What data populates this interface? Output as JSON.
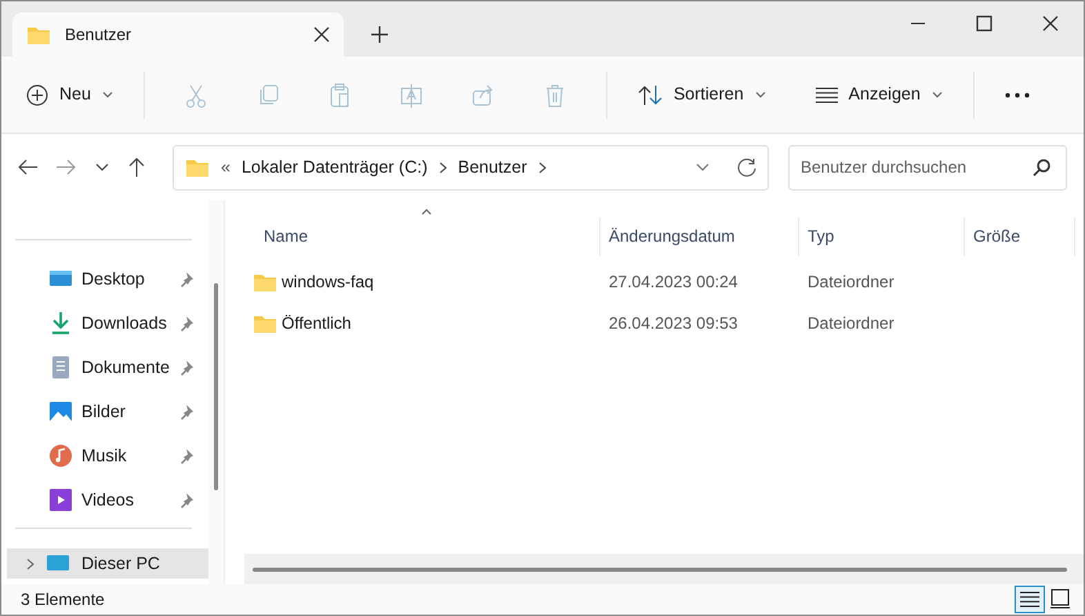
{
  "window": {
    "tab_title": "Benutzer"
  },
  "toolbar": {
    "new": {
      "label": "Neu"
    },
    "actions": [
      {
        "kind": "cut",
        "disabled": true
      },
      {
        "kind": "copy",
        "disabled": true
      },
      {
        "kind": "paste",
        "disabled": true
      },
      {
        "kind": "rename",
        "disabled": true
      },
      {
        "kind": "share",
        "disabled": true
      },
      {
        "kind": "delete",
        "disabled": true
      }
    ],
    "sort": {
      "label": "Sortieren"
    },
    "view": {
      "label": "Anzeigen"
    }
  },
  "address": {
    "overflow": "«",
    "segments": [
      "Lokaler Datenträger (C:)",
      "Benutzer"
    ],
    "search_placeholder": "Benutzer durchsuchen"
  },
  "sidebar": {
    "items": [
      {
        "kind": "desktop",
        "label": "Desktop",
        "pinned": true,
        "selected": false
      },
      {
        "kind": "downloads",
        "label": "Downloads",
        "pinned": true,
        "selected": false
      },
      {
        "kind": "documents",
        "label": "Dokumente",
        "pinned": true,
        "selected": false
      },
      {
        "kind": "pictures",
        "label": "Bilder",
        "pinned": true,
        "selected": false
      },
      {
        "kind": "music",
        "label": "Musik",
        "pinned": true,
        "selected": false
      },
      {
        "kind": "videos",
        "label": "Videos",
        "pinned": true,
        "selected": false
      }
    ],
    "this_pc": {
      "label": "Dieser PC",
      "selected": true
    }
  },
  "table": {
    "columns": [
      "Name",
      "Änderungsdatum",
      "Typ",
      "Größe"
    ],
    "rows": [
      {
        "name": "windows-faq",
        "modified": "27.04.2023 00:24",
        "type": "Dateiordner"
      },
      {
        "name": "Öffentlich",
        "modified": "26.04.2023 09:53",
        "type": "Dateiordner"
      }
    ]
  },
  "status_bar": {
    "count": "3 Elemente",
    "views": [
      {
        "kind": "details",
        "selected": true
      },
      {
        "kind": "tiles",
        "selected": false
      }
    ]
  }
}
